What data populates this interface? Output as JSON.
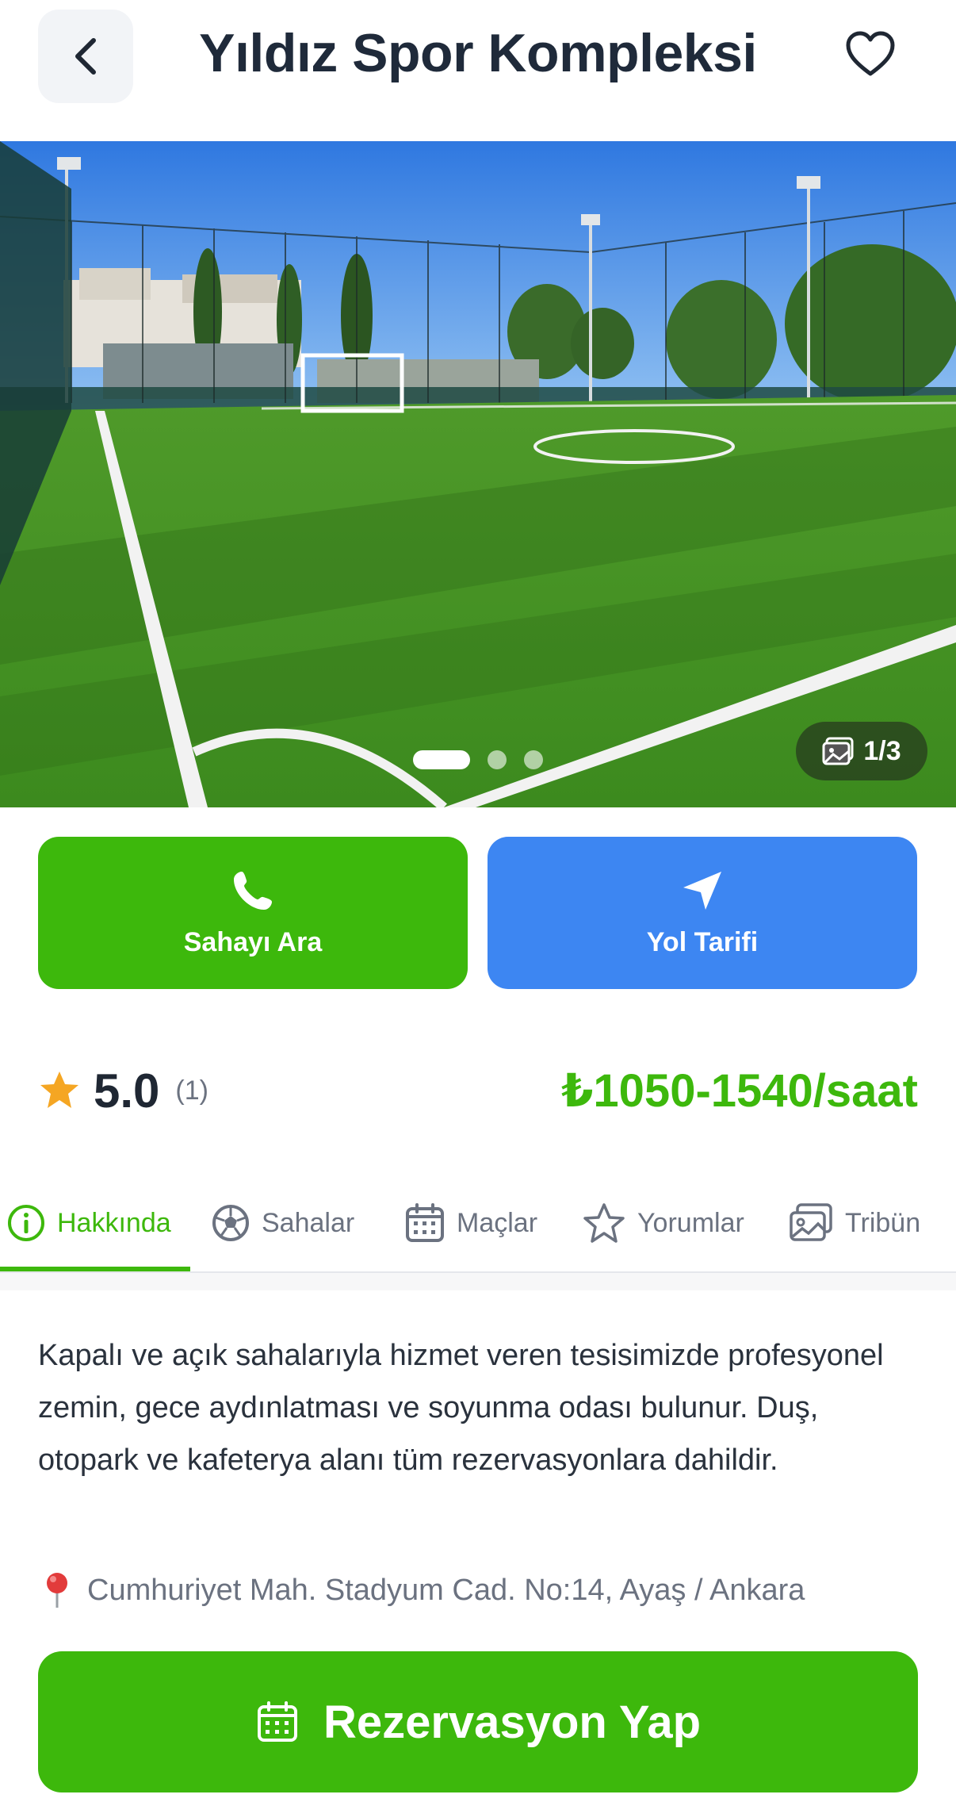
{
  "header": {
    "title": "Yıldız Spor Kompleksi",
    "back_icon": "chevron-left-icon",
    "favorite_icon": "heart-outline-icon"
  },
  "gallery": {
    "counter": "1/3",
    "counter_icon": "images-icon",
    "active_index": 0,
    "total": 3
  },
  "actions": {
    "call_label": "Sahayı Ara",
    "call_icon": "phone-icon",
    "directions_label": "Yol Tarifi",
    "directions_icon": "navigation-arrow-icon"
  },
  "rating": {
    "score": "5.0",
    "count": "(1)",
    "icon": "star-icon"
  },
  "price": "₺1050-1540/saat",
  "tabs": [
    {
      "label": "Hakkında",
      "icon": "info-icon",
      "active": true
    },
    {
      "label": "Sahalar",
      "icon": "soccer-ball-icon",
      "active": false
    },
    {
      "label": "Maçlar",
      "icon": "calendar-icon",
      "active": false
    },
    {
      "label": "Yorumlar",
      "icon": "star-outline-icon",
      "active": false
    },
    {
      "label": "Tribün",
      "icon": "images-icon",
      "active": false
    }
  ],
  "about": {
    "description": "Kapalı ve açık sahalarıyla hizmet veren tesisimizde profesyonel zemin, gece aydınlatması ve soyunma odası bulunur. Duş, otopark ve kafeterya alanı tüm rezervasyonlara dahildir.",
    "address": "Cumhuriyet Mah. Stadyum Cad. No:14, Ayaş / Ankara",
    "address_icon": "map-pin-icon"
  },
  "cta": {
    "label": "Rezervasyon Yap",
    "icon": "calendar-icon"
  },
  "colors": {
    "primary_green": "#3db80c",
    "accent_blue": "#3d86f2",
    "star": "#f5a623",
    "text_dark": "#1f2733",
    "text_muted": "#6b7280"
  }
}
